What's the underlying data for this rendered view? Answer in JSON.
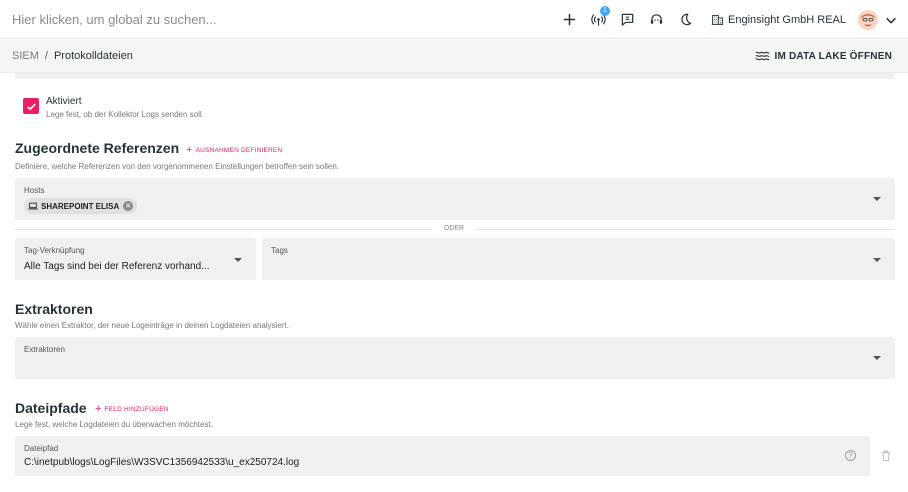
{
  "topbar": {
    "search_placeholder": "Hier klicken, um global zu suchen...",
    "notification_count": "1",
    "org_name": "Enginsight GmbH REAL"
  },
  "subbar": {
    "breadcrumb_root": "SIEM",
    "breadcrumb_separator": "/",
    "breadcrumb_current": "Protokolldateien",
    "data_lake_button": "IM DATA LAKE ÖFFNEN"
  },
  "activation": {
    "checked": true,
    "title": "Aktiviert",
    "description": "Lege fest, ob der Kollektor Logs senden soll."
  },
  "references": {
    "heading": "Zugeordnete Referenzen",
    "add_exceptions": "AUSNAHMEN DEFINIEREN",
    "description": "Definiere, welche Referenzen von den vorgenommenen Einstellungen betroffen sein sollen.",
    "hosts_label": "Hosts",
    "hosts": [
      {
        "label": "SHAREPOINT ELISA"
      }
    ],
    "or_divider": "ODER",
    "tag_link_label": "Tag-Verknüpfung",
    "tag_link_value": "Alle Tags sind bei der Referenz vorhand...",
    "tags_label": "Tags"
  },
  "extractors": {
    "heading": "Extraktoren",
    "description": "Wähle einen Extraktor, der neue Logeinträge in deinen Logdateien analysiert.",
    "field_label": "Extraktoren"
  },
  "filepaths": {
    "heading": "Dateipfade",
    "add_field": "FELD HINZUFÜGEN",
    "description": "Lege fest, welche Logdateien du überwachen möchtest.",
    "field_label": "Dateipfad",
    "field_value": "C:\\inetpub\\logs\\LogFiles\\W3SVC1356942533\\u_ex250724.log",
    "help_glyph": "?"
  },
  "colors": {
    "accent": "#e91e63",
    "badge": "#42a5f5",
    "field_bg": "#f0f0f0"
  }
}
